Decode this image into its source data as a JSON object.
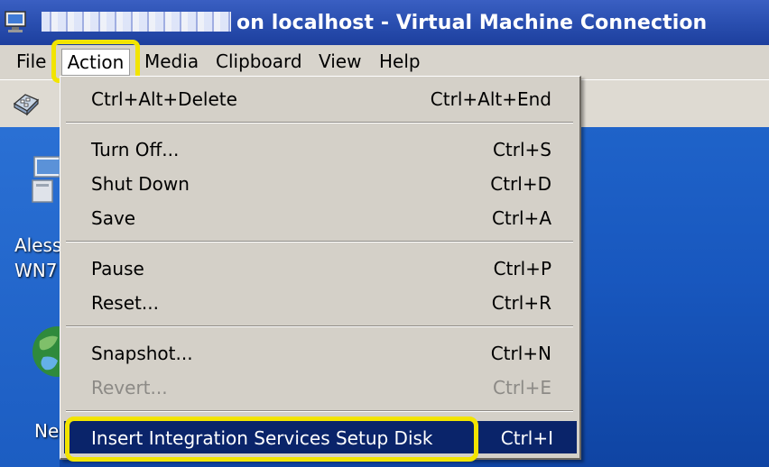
{
  "window": {
    "title_suffix": "on localhost - Virtual Machine Connection"
  },
  "menubar": {
    "items": [
      "File",
      "Action",
      "Media",
      "Clipboard",
      "View",
      "Help"
    ]
  },
  "desktop": {
    "icon1_label_line1": "Aless",
    "icon1_label_line2": "WN7",
    "icon2_label": "Ne"
  },
  "action_menu": {
    "items": [
      {
        "label": "Ctrl+Alt+Delete",
        "shortcut": "Ctrl+Alt+End",
        "enabled": true
      },
      {
        "label": "Turn Off...",
        "shortcut": "Ctrl+S",
        "enabled": true
      },
      {
        "label": "Shut Down",
        "shortcut": "Ctrl+D",
        "enabled": true
      },
      {
        "label": "Save",
        "shortcut": "Ctrl+A",
        "enabled": true
      },
      {
        "label": "Pause",
        "shortcut": "Ctrl+P",
        "enabled": true
      },
      {
        "label": "Reset...",
        "shortcut": "Ctrl+R",
        "enabled": true
      },
      {
        "label": "Snapshot...",
        "shortcut": "Ctrl+N",
        "enabled": true
      },
      {
        "label": "Revert...",
        "shortcut": "Ctrl+E",
        "enabled": false
      },
      {
        "label": "Insert Integration Services Setup Disk",
        "shortcut": "Ctrl+I",
        "enabled": true,
        "highlighted": true
      }
    ]
  },
  "colors": {
    "titlebar": "#2a4fb0",
    "highlight": "#0a246a",
    "callout": "#f2e400",
    "desktop": "#1857be"
  },
  "icons": [
    "vm-connection-icon",
    "ctrl-alt-del-toolbar-icon",
    "computer-icon",
    "network-globe-icon"
  ]
}
